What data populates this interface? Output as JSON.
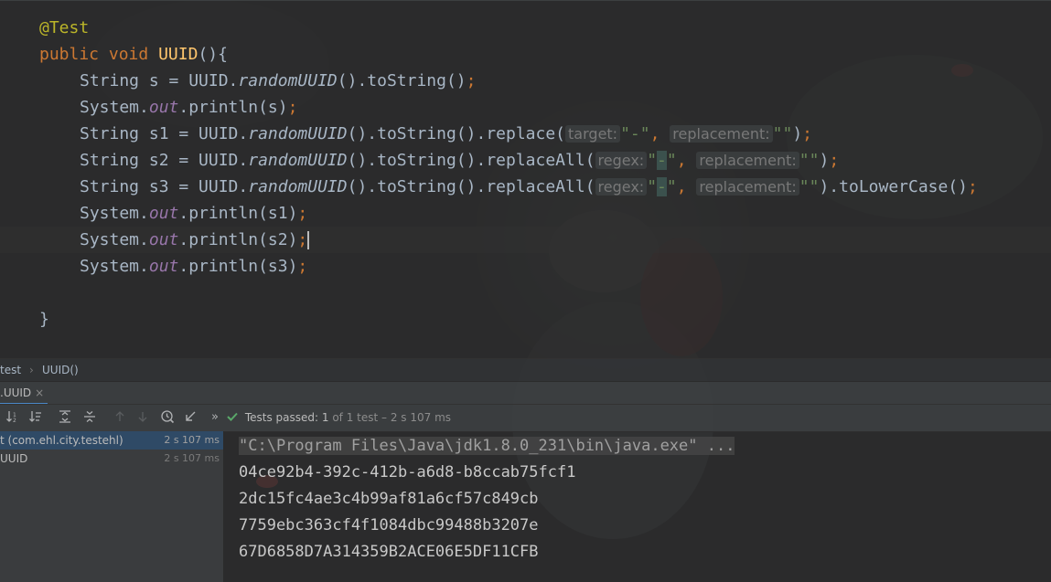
{
  "editor": {
    "lines": {
      "l1": {
        "annotation": "@Test"
      },
      "l2": {
        "kw1": "public",
        "kw2": "void",
        "method": "UUID",
        "paren": "(){"
      },
      "l3": {
        "a": "String s = UUID.",
        "b": "randomUUID",
        "c": "().toString()",
        "semi": ";"
      },
      "l4": {
        "a": "System.",
        "field": "out",
        "b": ".println(s)",
        "semi": ";"
      },
      "l5": {
        "a": "String s1 = UUID.",
        "b": "randomUUID",
        "c": "().toString().replace(",
        "hint1": "target:",
        "str1": "\"-\"",
        "comma": ",",
        "hint2": "replacement:",
        "str2": "\"\"",
        "end": ")",
        "semi": ";"
      },
      "l6": {
        "a": "String s2 = UUID.",
        "b": "randomUUID",
        "c": "().toString().replaceAll(",
        "hint1": "regex:",
        "q1": "\"",
        "dash": "-",
        "q2": "\"",
        "comma": ",",
        "hint2": "replacement:",
        "str2": "\"\"",
        "end": ")",
        "semi": ";"
      },
      "l7": {
        "a": "String s3 = UUID.",
        "b": "randomUUID",
        "c": "().toString().replaceAll(",
        "hint1": "regex:",
        "q1": "\"",
        "dash": "-",
        "q2": "\"",
        "comma": ",",
        "hint2": "replacement:",
        "str2": "\"\"",
        "end": ").toLowerCase()",
        "semi": ";"
      },
      "l8": {
        "a": "System.",
        "field": "out",
        "b": ".println(s1)",
        "semi": ";"
      },
      "l9": {
        "a": "System.",
        "field": "out",
        "b": ".println(s2)",
        "semi": ";"
      },
      "l10": {
        "a": "System.",
        "field": "out",
        "b": ".println(s3)",
        "semi": ";"
      },
      "l12": {
        "brace": "}"
      }
    }
  },
  "breadcrumb": {
    "class": "test",
    "sep": "›",
    "method": "UUID()"
  },
  "run_tab": {
    "label": ".UUID",
    "close": "×"
  },
  "toolbar": {
    "icons": [
      "sort-alpha-icon",
      "sort-duration-icon",
      "expand-all-icon",
      "collapse-all-icon",
      "prev-failed-icon",
      "next-failed-icon",
      "test-history-icon",
      "import-tests-icon",
      "more-icon"
    ],
    "more": "»",
    "status_prefix": "Tests passed:",
    "status_count": "1",
    "status_rest": "of 1 test – 2 s 107 ms"
  },
  "tree": {
    "rows": [
      {
        "label": "t (com.ehl.city.testehl)",
        "duration": "2 s 107 ms"
      },
      {
        "label": "UUID",
        "duration": "2 s 107 ms"
      }
    ]
  },
  "console": {
    "command": "\"C:\\Program Files\\Java\\jdk1.8.0_231\\bin\\java.exe\" ...",
    "output": [
      "04ce92b4-392c-412b-a6d8-b8ccab75fcf1",
      "2dc15fc4ae3c4b99af81a6cf57c849cb",
      "7759ebc363cf4f1084dbc99488b3207e",
      "67D6858D7A314359B2ACE06E5DF11CFB"
    ]
  },
  "colors": {
    "keyword": "#cc7832",
    "method": "#ffc66d",
    "string": "#6a8759",
    "field": "#9876aa",
    "annotation": "#bbb529",
    "pass": "#59a869"
  }
}
